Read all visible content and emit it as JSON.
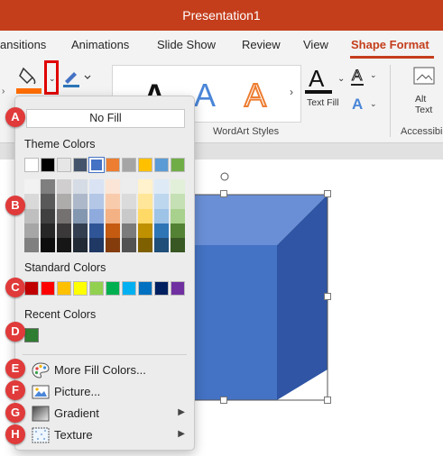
{
  "window": {
    "title": "Presentation1"
  },
  "tabs": [
    "ansitions",
    "Animations",
    "Slide Show",
    "Review",
    "View",
    "Shape Format"
  ],
  "active_tab": "Shape Format",
  "ribbon": {
    "wordart_styles_label": "WordArt Styles",
    "text_fill_label": "Text Fill",
    "alt_text_label": "Alt Text",
    "accessibility_label": "Accessibi",
    "wordart_letter": "A",
    "accent_color": "#ff6d00"
  },
  "menu": {
    "no_fill": "No Fill",
    "theme_colors_label": "Theme Colors",
    "standard_colors_label": "Standard Colors",
    "recent_colors_label": "Recent Colors",
    "theme_colors": [
      "#ffffff",
      "#000000",
      "#e7e6e6",
      "#44546a",
      "#4472c4",
      "#ed7d31",
      "#a5a5a5",
      "#ffc000",
      "#5b9bd5",
      "#70ad47"
    ],
    "theme_shades": [
      [
        "#f2f2f2",
        "#d9d9d9",
        "#bfbfbf",
        "#a6a6a6",
        "#808080"
      ],
      [
        "#7f7f7f",
        "#595959",
        "#404040",
        "#262626",
        "#0d0d0d"
      ],
      [
        "#d0cece",
        "#aeabab",
        "#757171",
        "#3a3838",
        "#171616"
      ],
      [
        "#d6dce5",
        "#adb9ca",
        "#8497b0",
        "#333f50",
        "#222a35"
      ],
      [
        "#dae3f3",
        "#b4c7e7",
        "#8faadc",
        "#2f5597",
        "#1f3864"
      ],
      [
        "#fbe5d6",
        "#f8cbad",
        "#f4b183",
        "#c55a11",
        "#843c0c"
      ],
      [
        "#ededed",
        "#dbdbdb",
        "#c9c9c9",
        "#7b7b7b",
        "#525252"
      ],
      [
        "#fff2cc",
        "#ffe699",
        "#ffd966",
        "#bf9000",
        "#7f6000"
      ],
      [
        "#deebf7",
        "#bdd7ee",
        "#9dc3e6",
        "#2e75b6",
        "#1f4e79"
      ],
      [
        "#e2f0d9",
        "#c5e0b4",
        "#a9d18e",
        "#548235",
        "#385723"
      ]
    ],
    "standard_colors": [
      "#c00000",
      "#ff0000",
      "#ffc000",
      "#ffff00",
      "#92d050",
      "#00b050",
      "#00b0f0",
      "#0070c0",
      "#002060",
      "#7030a0"
    ],
    "recent_colors": [
      "#2e7d32"
    ],
    "items": [
      {
        "label": "More Fill Colors...",
        "icon": "palette-icon",
        "has_submenu": false
      },
      {
        "label": "Picture...",
        "icon": "picture-icon",
        "has_submenu": false
      },
      {
        "label": "Gradient",
        "icon": "gradient-icon",
        "has_submenu": true
      },
      {
        "label": "Texture",
        "icon": "texture-icon",
        "has_submenu": true
      }
    ],
    "submenu_arrow": "▶"
  },
  "callouts": [
    "A",
    "B",
    "C",
    "D",
    "E",
    "F",
    "G",
    "H"
  ],
  "shape": {
    "front_color": "#4472c4",
    "top_color": "#6a8fd6",
    "side_color": "#2f55a4"
  }
}
